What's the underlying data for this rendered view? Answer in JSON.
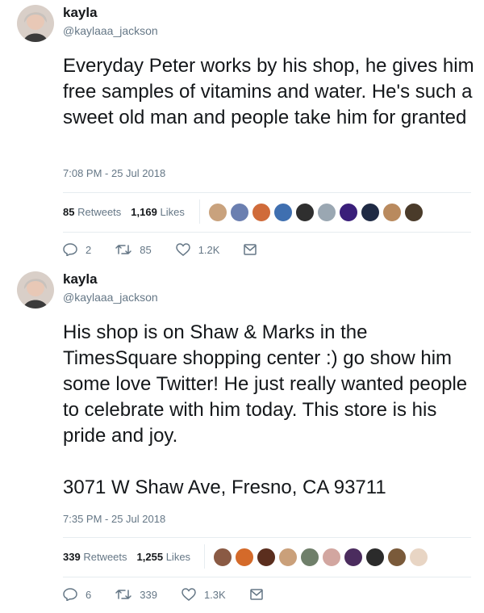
{
  "tweets": [
    {
      "name": "kayla",
      "handle": "@kaylaaa_jackson",
      "text": "Everyday Peter works by his shop, he gives him free samples of vitamins and water. He's such a sweet old man and people take him for granted",
      "timestamp": "7:08 PM - 25 Jul 2018",
      "retweets_count": "85",
      "retweets_label": "Retweets",
      "likes_count": "1,169",
      "likes_label": "Likes",
      "reply_count": "2",
      "retweet_count": "85",
      "like_count": "1.2K",
      "liker_colors": [
        "#c9a27d",
        "#6b7fb0",
        "#d06b3a",
        "#3f6fb0",
        "#2f2f2f",
        "#9aa7b2",
        "#3a1f7a",
        "#1f2a44",
        "#b98a5e",
        "#4a3b2a"
      ]
    },
    {
      "name": "kayla",
      "handle": "@kaylaaa_jackson",
      "text": "His shop is on Shaw & Marks in the TimesSquare shopping center :) go show him some love Twitter! He just really wanted people to celebrate with him today. This store is his pride and joy.\n\n3071 W Shaw Ave, Fresno, CA 93711",
      "timestamp": "7:35 PM - 25 Jul 2018",
      "retweets_count": "339",
      "retweets_label": "Retweets",
      "likes_count": "1,255",
      "likes_label": "Likes",
      "reply_count": "6",
      "retweet_count": "339",
      "like_count": "1.3K",
      "liker_colors": [
        "#8a5a44",
        "#d46a2a",
        "#5b2e1e",
        "#caa07a",
        "#6f7f6a",
        "#d2a6a0",
        "#4b2c5e",
        "#2b2b2b",
        "#7a5a3a",
        "#e8d5c4"
      ]
    }
  ],
  "colors": {
    "text": "#14171a",
    "secondary": "#657786",
    "divider": "#e6ecf0"
  },
  "icons": [
    "avatar-icon",
    "reply-icon",
    "retweet-icon",
    "like-icon",
    "message-icon"
  ]
}
